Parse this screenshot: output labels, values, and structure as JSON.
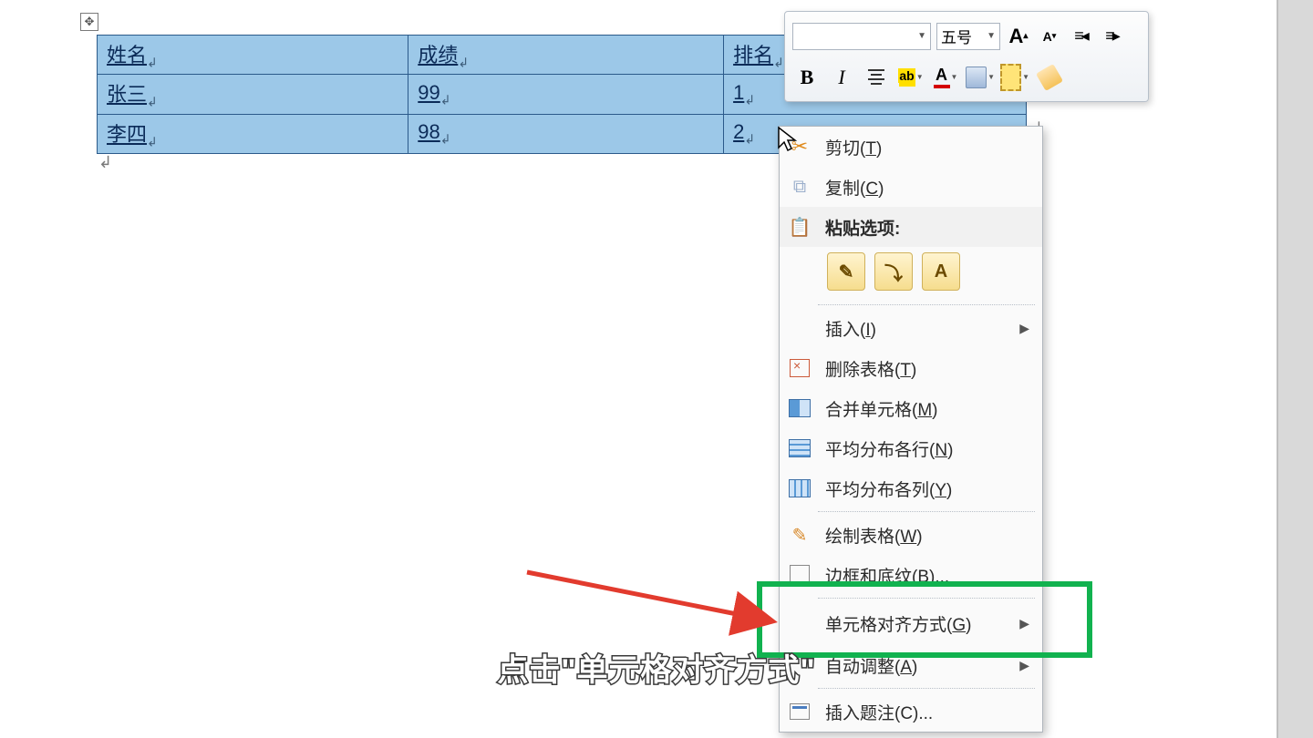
{
  "table": {
    "headers": [
      "姓名",
      "成绩",
      "排名"
    ],
    "rows": [
      [
        "张三",
        "99",
        "1"
      ],
      [
        "李四",
        "98",
        "2"
      ]
    ]
  },
  "mini_toolbar": {
    "font_name": "",
    "font_size": "五号",
    "grow_font": "A",
    "shrink_font": "A",
    "bold": "B",
    "italic": "I",
    "highlight_label": "ab",
    "font_color_label": "A"
  },
  "context_menu": {
    "cut": "剪切(T)",
    "copy": "复制(C)",
    "paste_options": "粘贴选项:",
    "paste_opts": {
      "keep": "✎",
      "merge": "⤵",
      "text_only": "A"
    },
    "insert": "插入(I)",
    "delete_table": "删除表格(T)",
    "merge_cells": "合并单元格(M)",
    "distribute_rows": "平均分布各行(N)",
    "distribute_cols": "平均分布各列(Y)",
    "draw_table": "绘制表格(W)",
    "borders": "边框和底纹(B)...",
    "cell_align": "单元格对齐方式(G)",
    "autofit": "自动调整(A)",
    "caption": "插入题注(C)..."
  },
  "subtitle": "点击\"单元格对齐方式\"",
  "para_mark": "↲"
}
